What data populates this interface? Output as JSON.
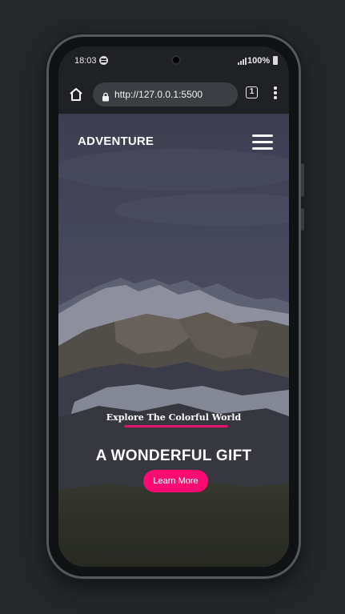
{
  "status_bar": {
    "time": "18:03",
    "battery": "100%",
    "icons": [
      "spotify-icon",
      "camera",
      "signal-icon",
      "battery-icon"
    ]
  },
  "browser": {
    "url": "http://127.0.0.1:5500",
    "tab_count": "1",
    "icons": [
      "home-icon",
      "lock-icon",
      "tabs-icon",
      "more-menu-icon"
    ]
  },
  "page": {
    "brand": "ADVENTURE",
    "subtitle": "Explore The Colorful World",
    "title": "A WONDERFUL GIFT",
    "cta_label": "Learn More",
    "menu_icon": "hamburger-icon"
  },
  "colors": {
    "accent": "#ff0a73",
    "underline": "#e5146c",
    "chrome": "#1f2124"
  }
}
